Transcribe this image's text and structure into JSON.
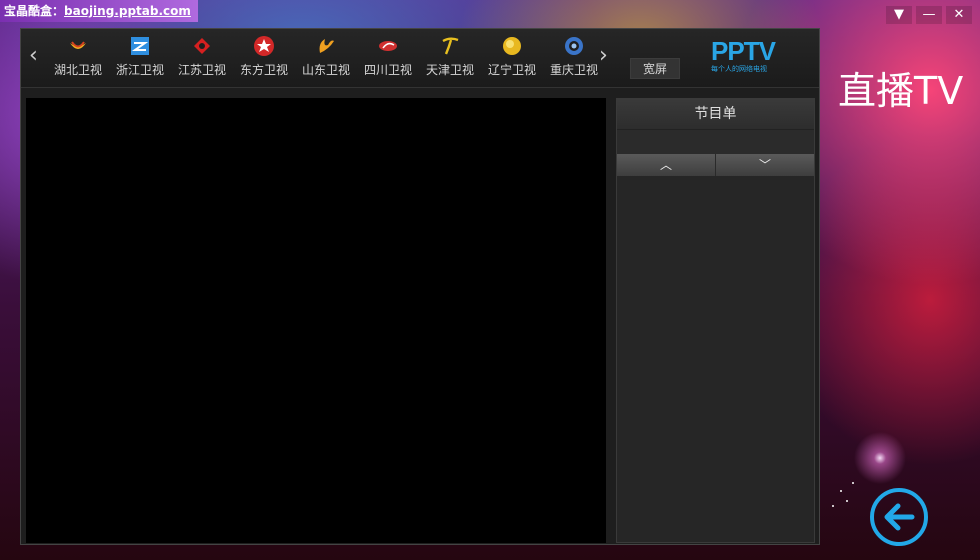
{
  "site": {
    "prefix": "宝晶酷盒：",
    "url": "baojing.pptab.com"
  },
  "window_controls": {
    "menu": "▼",
    "minimize": "—",
    "close": "✕"
  },
  "nav": {
    "prev": "‹",
    "next": "›"
  },
  "channels": [
    {
      "label": "湖北卫视",
      "icon": "hubei-logo-icon",
      "color": "#d8421e"
    },
    {
      "label": "浙江卫视",
      "icon": "zhejiang-logo-icon",
      "color": "#2f8fe0"
    },
    {
      "label": "江苏卫视",
      "icon": "jiangsu-logo-icon",
      "color": "#d62020"
    },
    {
      "label": "东方卫视",
      "icon": "dongfang-logo-icon",
      "color": "#d32828"
    },
    {
      "label": "山东卫视",
      "icon": "shandong-logo-icon",
      "color": "#f0a020"
    },
    {
      "label": "四川卫视",
      "icon": "sichuan-logo-icon",
      "color": "#d03030"
    },
    {
      "label": "天津卫视",
      "icon": "tianjin-logo-icon",
      "color": "#e8c020"
    },
    {
      "label": "辽宁卫视",
      "icon": "liaoning-logo-icon",
      "color": "#e8b820"
    },
    {
      "label": "重庆卫视",
      "icon": "chongqing-logo-icon",
      "color": "#3a74c8"
    }
  ],
  "toolbar": {
    "wide_button": "宽屏"
  },
  "pptv": {
    "logo": "PPTV",
    "slogan": "每个人的网络电视"
  },
  "program": {
    "title": "节目单",
    "up": "︿",
    "down": "﹀"
  },
  "page": {
    "title": "直播TV"
  },
  "colors": {
    "accent": "#2aa6e6",
    "window_bg": "#1e1e1e"
  }
}
